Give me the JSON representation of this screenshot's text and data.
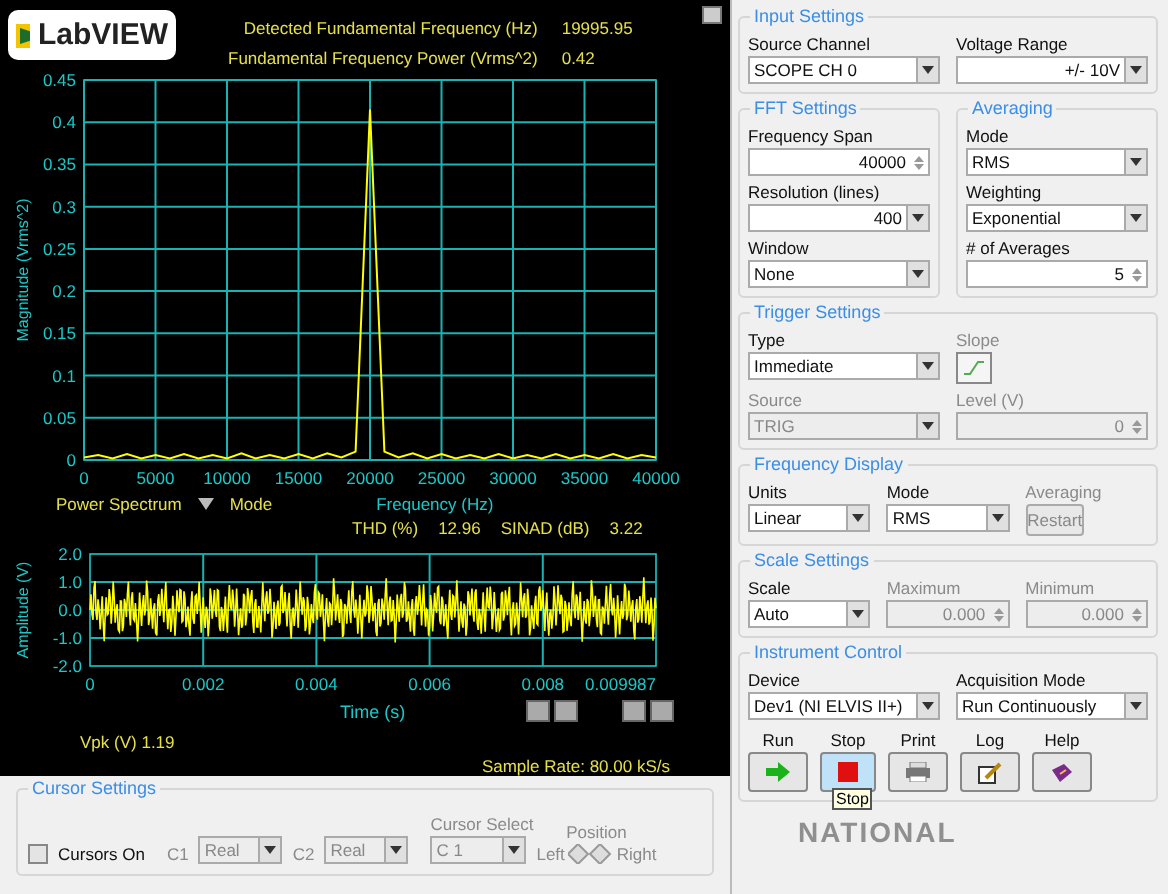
{
  "header": {
    "logo": "LabVIEW",
    "readouts": [
      {
        "label": "Detected Fundamental Frequency (Hz)",
        "value": "19995.95"
      },
      {
        "label": "Fundamental Frequency Power (Vrms^2)",
        "value": "0.42"
      }
    ]
  },
  "spectrum": {
    "mode_label": "Mode",
    "chart_data": {
      "type": "line",
      "xlabel": "Frequency (Hz)",
      "ylabel": "Magnitude (Vrms^2)",
      "grid": true,
      "x": [
        0,
        1000,
        2000,
        3000,
        4000,
        5000,
        6000,
        7000,
        8000,
        9000,
        10000,
        11000,
        12000,
        13000,
        14000,
        15000,
        16000,
        17000,
        18000,
        19000,
        20000,
        21000,
        22000,
        23000,
        24000,
        25000,
        26000,
        27000,
        28000,
        29000,
        30000,
        31000,
        32000,
        33000,
        34000,
        35000,
        36000,
        37000,
        38000,
        39000,
        40000
      ],
      "series": [
        {
          "name": "Power Spectrum",
          "color": "#ffff00",
          "values": [
            0.003,
            0.006,
            0.002,
            0.007,
            0.002,
            0.006,
            0.002,
            0.007,
            0.002,
            0.006,
            0.002,
            0.008,
            0.002,
            0.006,
            0.002,
            0.007,
            0.002,
            0.008,
            0.003,
            0.01,
            0.415,
            0.01,
            0.003,
            0.008,
            0.002,
            0.007,
            0.002,
            0.006,
            0.002,
            0.007,
            0.002,
            0.006,
            0.002,
            0.007,
            0.002,
            0.006,
            0.002,
            0.007,
            0.002,
            0.006,
            0.003
          ]
        }
      ],
      "xlim": [
        0,
        40000
      ],
      "ylim": [
        0,
        0.45
      ],
      "xticks": [
        0,
        5000,
        10000,
        15000,
        20000,
        25000,
        30000,
        35000,
        40000
      ],
      "yticks": [
        0,
        0.05,
        0.1,
        0.15,
        0.2,
        0.25,
        0.3,
        0.35,
        0.4,
        0.45
      ]
    }
  },
  "measurements": [
    {
      "label": "THD (%)",
      "value": "12.96"
    },
    {
      "label": "SINAD (dB)",
      "value": "3.22"
    }
  ],
  "waveform": {
    "xlabel": "Time (s)",
    "ylabel": "Amplitude (V)",
    "xticks": [
      "0",
      "0.002",
      "0.004",
      "0.006",
      "0.008",
      "0.009987"
    ],
    "yticks": [
      "2.0",
      "1.0",
      "0.0",
      "-1.0",
      "-2.0"
    ]
  },
  "vpk": {
    "label": "Vpk (V)",
    "value": "1.19"
  },
  "sample_rate": {
    "label": "Sample Rate:",
    "value": "80.00 kS/s"
  },
  "cursor_settings": {
    "title": "Cursor Settings",
    "disabled": true,
    "cursors_on": {
      "label": "Cursors On",
      "checked": false
    },
    "c1": {
      "label": "C1",
      "value": "Real"
    },
    "c2": {
      "label": "C2",
      "value": "Real"
    },
    "cursor_select": {
      "label": "Cursor Select",
      "value": "C 1"
    },
    "position": {
      "label": "Position",
      "left": "Left",
      "right": "Right"
    }
  },
  "settings": [
    {
      "kind": "group",
      "title": "Input Settings",
      "rows": [
        [
          {
            "kind": "dropdown",
            "label": "Source Channel",
            "value": "SCOPE CH 0",
            "disabled": false
          },
          {
            "kind": "ring",
            "label": "Voltage Range",
            "value": "+/- 10V",
            "disabled": false
          }
        ]
      ]
    },
    {
      "kind": "pair",
      "groups": [
        {
          "title": "FFT Settings",
          "rows": [
            [
              {
                "kind": "numeric",
                "label": "Frequency Span",
                "value": "40000",
                "disabled": false
              }
            ],
            [
              {
                "kind": "ring",
                "label": "Resolution (lines)",
                "value": "400",
                "disabled": false
              }
            ],
            [
              {
                "kind": "dropdown",
                "label": "Window",
                "value": "None",
                "disabled": false
              }
            ]
          ]
        },
        {
          "title": "Averaging",
          "rows": [
            [
              {
                "kind": "dropdown",
                "label": "Mode",
                "value": "RMS",
                "disabled": false
              }
            ],
            [
              {
                "kind": "dropdown",
                "label": "Weighting",
                "value": "Exponential",
                "disabled": false
              }
            ],
            [
              {
                "kind": "numeric",
                "label": "# of Averages",
                "value": "5",
                "disabled": false
              }
            ]
          ]
        }
      ]
    },
    {
      "kind": "group",
      "title": "Trigger Settings",
      "rows": [
        [
          {
            "kind": "dropdown",
            "label": "Type",
            "value": "Immediate",
            "disabled": false
          },
          {
            "kind": "slope",
            "label": "Slope",
            "disabled": true
          }
        ],
        [
          {
            "kind": "dropdown",
            "label": "Source",
            "value": "TRIG",
            "disabled": true
          },
          {
            "kind": "numeric",
            "label": "Level (V)",
            "value": "0",
            "disabled": true
          }
        ]
      ]
    },
    {
      "kind": "group",
      "title": "Frequency Display",
      "rows": [
        [
          {
            "kind": "dropdown",
            "label": "Units",
            "value": "Linear",
            "disabled": false
          },
          {
            "kind": "dropdown",
            "label": "Mode",
            "value": "RMS",
            "disabled": false
          },
          {
            "kind": "button",
            "label": "Averaging",
            "value": "Restart",
            "disabled": true
          }
        ]
      ]
    },
    {
      "kind": "group",
      "title": "Scale Settings",
      "rows": [
        [
          {
            "kind": "dropdown",
            "label": "Scale",
            "value": "Auto",
            "disabled": false
          },
          {
            "kind": "numeric",
            "label": "Maximum",
            "value": "0.000",
            "disabled": true
          },
          {
            "kind": "numeric",
            "label": "Minimum",
            "value": "0.000",
            "disabled": true
          }
        ]
      ]
    },
    {
      "kind": "instrument",
      "title": "Instrument Control",
      "rows": [
        [
          {
            "kind": "dropdown",
            "label": "Device",
            "value": "Dev1 (NI ELVIS II+)",
            "disabled": false
          },
          {
            "kind": "dropdown",
            "label": "Acquisition Mode",
            "value": "Run Continuously",
            "disabled": false
          }
        ]
      ],
      "buttons": [
        {
          "kind": "run",
          "label": "Run",
          "highlighted": false
        },
        {
          "kind": "stop",
          "label": "Stop",
          "highlighted": true,
          "tooltip": "Stop"
        },
        {
          "kind": "print",
          "label": "Print",
          "highlighted": false
        },
        {
          "kind": "log",
          "label": "Log",
          "highlighted": false
        },
        {
          "kind": "help",
          "label": "Help",
          "highlighted": false
        }
      ]
    }
  ],
  "footer_logo": "NATIONAL"
}
